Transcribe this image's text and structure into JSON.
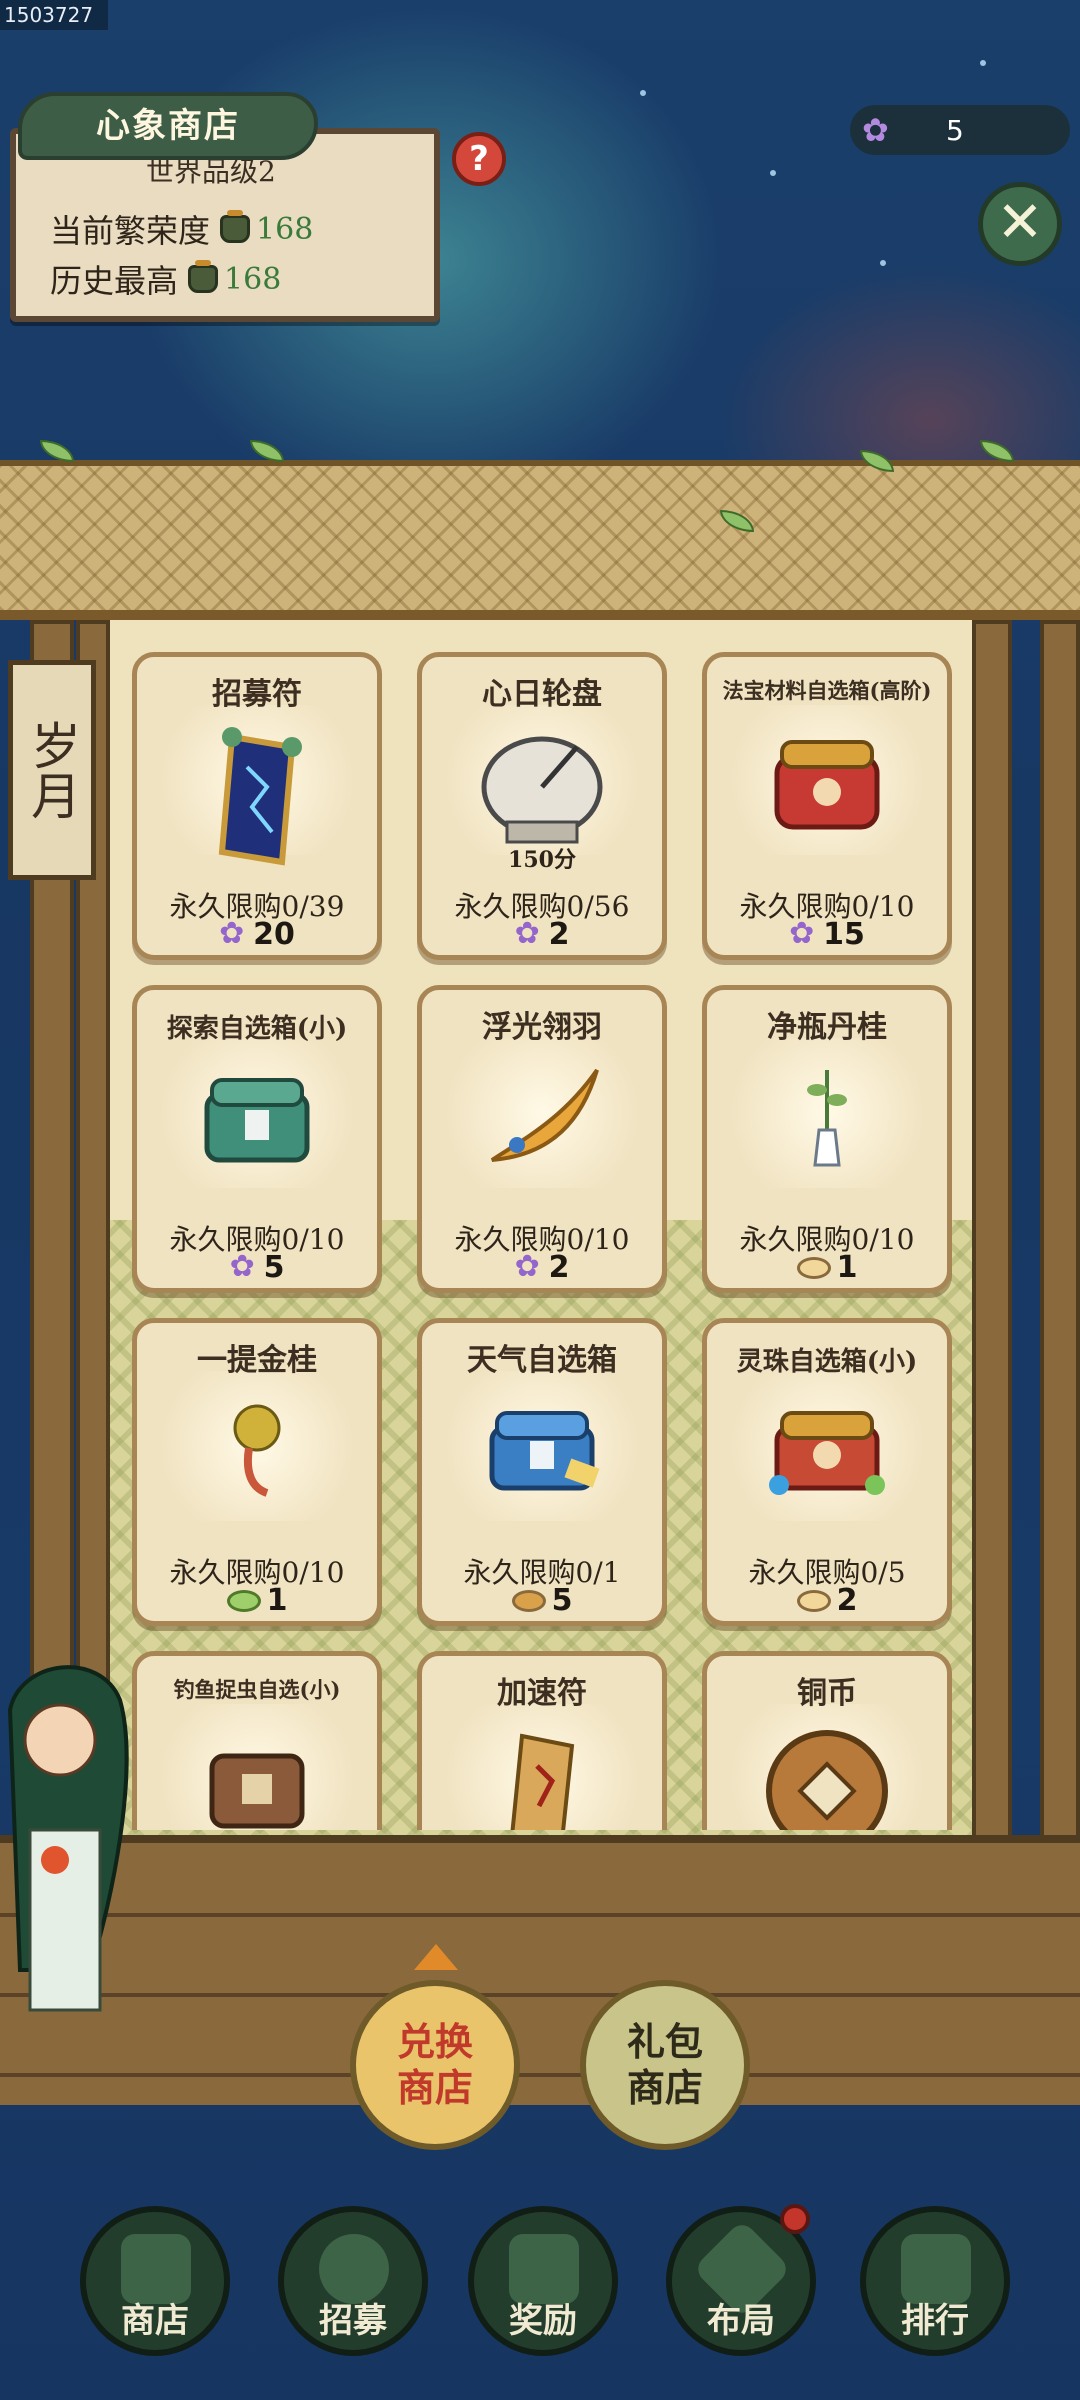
{
  "screen_id": "1503727",
  "shop_title": "心象商店",
  "info": {
    "world_tier": "世界品级2",
    "current_label": "当前繁荣度",
    "current_value": "168",
    "history_label": "历史最高",
    "history_value": "168"
  },
  "help_label": "?",
  "currency": {
    "icon": "lotus-icon",
    "amount": "5"
  },
  "close_label": "✕",
  "banner_text": "岁月",
  "items": [
    {
      "name": "招募符",
      "limit": "永久限购0/39",
      "price": "20",
      "price_icon": "lotus-icon"
    },
    {
      "name": "心日轮盘",
      "sub": "150分",
      "limit": "永久限购0/56",
      "price": "2",
      "price_icon": "lotus-icon"
    },
    {
      "name": "法宝材料自选箱(高阶)",
      "limit": "永久限购0/10",
      "price": "15",
      "price_icon": "lotus-icon"
    },
    {
      "name": "探索自选箱(小)",
      "limit": "永久限购0/10",
      "price": "5",
      "price_icon": "lotus-icon"
    },
    {
      "name": "浮光翎羽",
      "limit": "永久限购0/10",
      "price": "2",
      "price_icon": "lotus-icon"
    },
    {
      "name": "净瓶丹桂",
      "limit": "永久限购0/10",
      "price": "1",
      "price_icon": "coin-icon"
    },
    {
      "name": "一提金桂",
      "limit": "永久限购0/10",
      "price": "1",
      "price_icon": "leaf-coin-icon"
    },
    {
      "name": "天气自选箱",
      "limit": "永久限购0/1",
      "price": "5",
      "price_icon": "cookie-icon"
    },
    {
      "name": "灵珠自选箱(小)",
      "limit": "永久限购0/5",
      "price": "2",
      "price_icon": "coin-icon"
    },
    {
      "name": "钓鱼捉虫自选(小)",
      "limit": "",
      "price": "",
      "price_icon": ""
    },
    {
      "name": "加速符",
      "limit": "",
      "price": "",
      "price_icon": ""
    },
    {
      "name": "铜币",
      "limit": "",
      "price": "",
      "price_icon": ""
    }
  ],
  "shop_tabs": {
    "exchange": "兑换\n商店",
    "exchange_line1": "兑换",
    "exchange_line2": "商店",
    "gift_line1": "礼包",
    "gift_line2": "商店"
  },
  "nav": [
    {
      "label": "商店",
      "icon": "shop-icon"
    },
    {
      "label": "招募",
      "icon": "swirl-icon"
    },
    {
      "label": "奖励",
      "icon": "gift-icon"
    },
    {
      "label": "布局",
      "icon": "layout-icon"
    },
    {
      "label": "排行",
      "icon": "ranking-icon"
    }
  ],
  "colors": {
    "sky": "#183763",
    "card": "#f0e3c2",
    "card_border": "#a88554",
    "button_active": "#e9c46a",
    "button_inactive": "#c9c489",
    "nav_bg": "#233d2c"
  }
}
